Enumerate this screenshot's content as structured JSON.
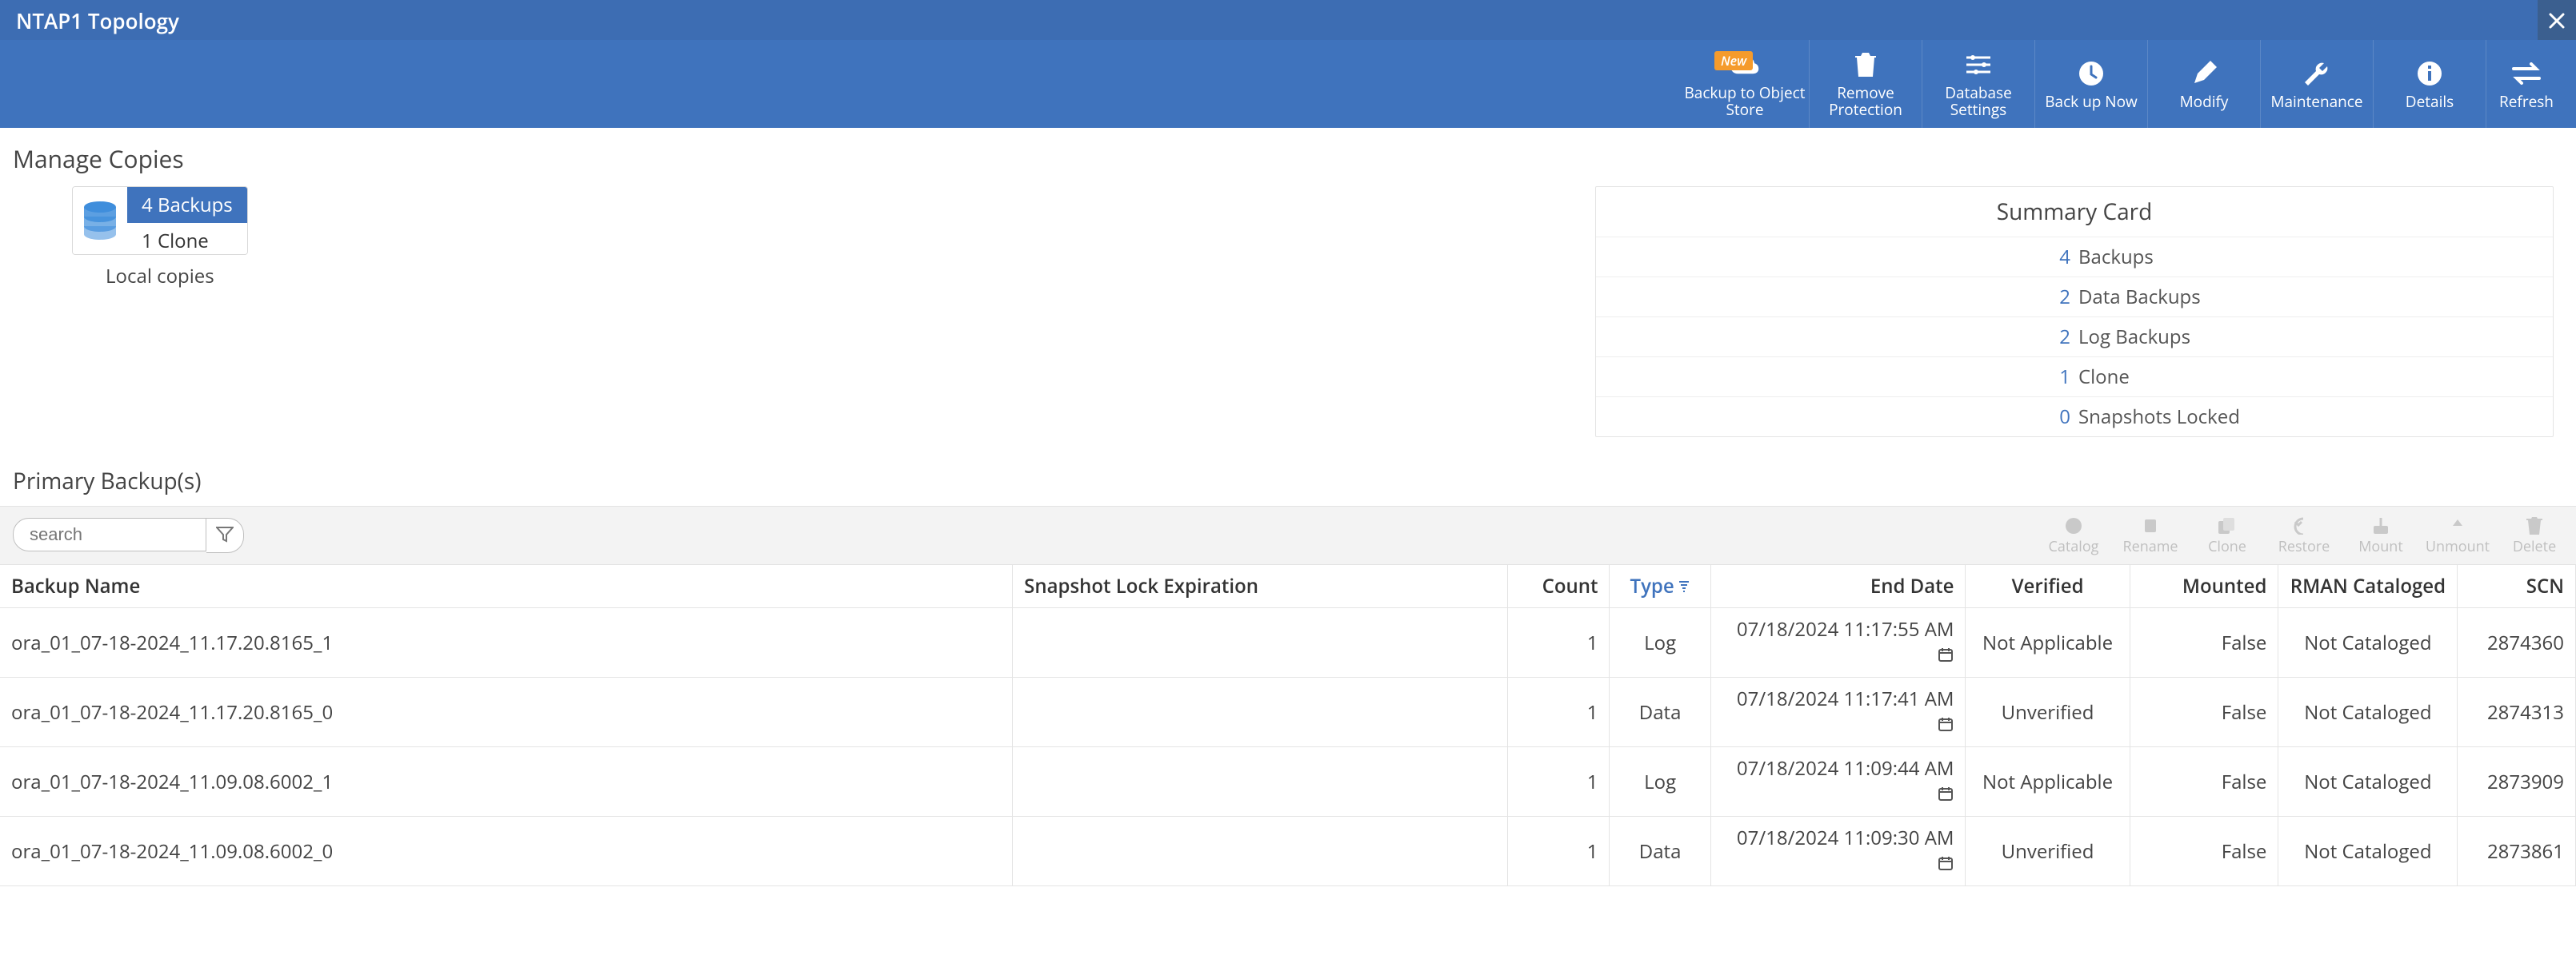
{
  "titlebar": {
    "title": "NTAP1 Topology"
  },
  "toolbar": {
    "new_tag": "New",
    "backup_to_object_store": "Backup to Object Store",
    "remove_protection": "Remove Protection",
    "database_settings": "Database Settings",
    "back_up_now": "Back up Now",
    "modify": "Modify",
    "maintenance": "Maintenance",
    "details": "Details",
    "refresh": "Refresh"
  },
  "manage_copies": {
    "title": "Manage Copies",
    "local": {
      "backups": "4 Backups",
      "clones": "1 Clone",
      "label": "Local copies"
    }
  },
  "summary": {
    "title": "Summary Card",
    "rows": [
      {
        "num": "4",
        "txt": "Backups"
      },
      {
        "num": "2",
        "txt": "Data Backups"
      },
      {
        "num": "2",
        "txt": "Log Backups"
      },
      {
        "num": "1",
        "txt": "Clone"
      },
      {
        "num": "0",
        "txt": "Snapshots Locked"
      }
    ]
  },
  "primary_backups": {
    "title": "Primary Backup(s)",
    "search_placeholder": "search",
    "actions": {
      "catalog": "Catalog",
      "rename": "Rename",
      "clone": "Clone",
      "restore": "Restore",
      "mount": "Mount",
      "unmount": "Unmount",
      "delete": "Delete"
    },
    "columns": {
      "name": "Backup Name",
      "sle": "Snapshot Lock Expiration",
      "count": "Count",
      "type": "Type",
      "end": "End Date",
      "verified": "Verified",
      "mounted": "Mounted",
      "rman": "RMAN Cataloged",
      "scn": "SCN"
    },
    "rows": [
      {
        "name": "ora_01_07-18-2024_11.17.20.8165_1",
        "sle": "",
        "count": "1",
        "type": "Log",
        "end": "07/18/2024 11:17:55 AM",
        "verified": "Not Applicable",
        "mounted": "False",
        "rman": "Not Cataloged",
        "scn": "2874360"
      },
      {
        "name": "ora_01_07-18-2024_11.17.20.8165_0",
        "sle": "",
        "count": "1",
        "type": "Data",
        "end": "07/18/2024 11:17:41 AM",
        "verified": "Unverified",
        "mounted": "False",
        "rman": "Not Cataloged",
        "scn": "2874313"
      },
      {
        "name": "ora_01_07-18-2024_11.09.08.6002_1",
        "sle": "",
        "count": "1",
        "type": "Log",
        "end": "07/18/2024 11:09:44 AM",
        "verified": "Not Applicable",
        "mounted": "False",
        "rman": "Not Cataloged",
        "scn": "2873909"
      },
      {
        "name": "ora_01_07-18-2024_11.09.08.6002_0",
        "sle": "",
        "count": "1",
        "type": "Data",
        "end": "07/18/2024 11:09:30 AM",
        "verified": "Unverified",
        "mounted": "False",
        "rman": "Not Cataloged",
        "scn": "2873861"
      }
    ]
  }
}
